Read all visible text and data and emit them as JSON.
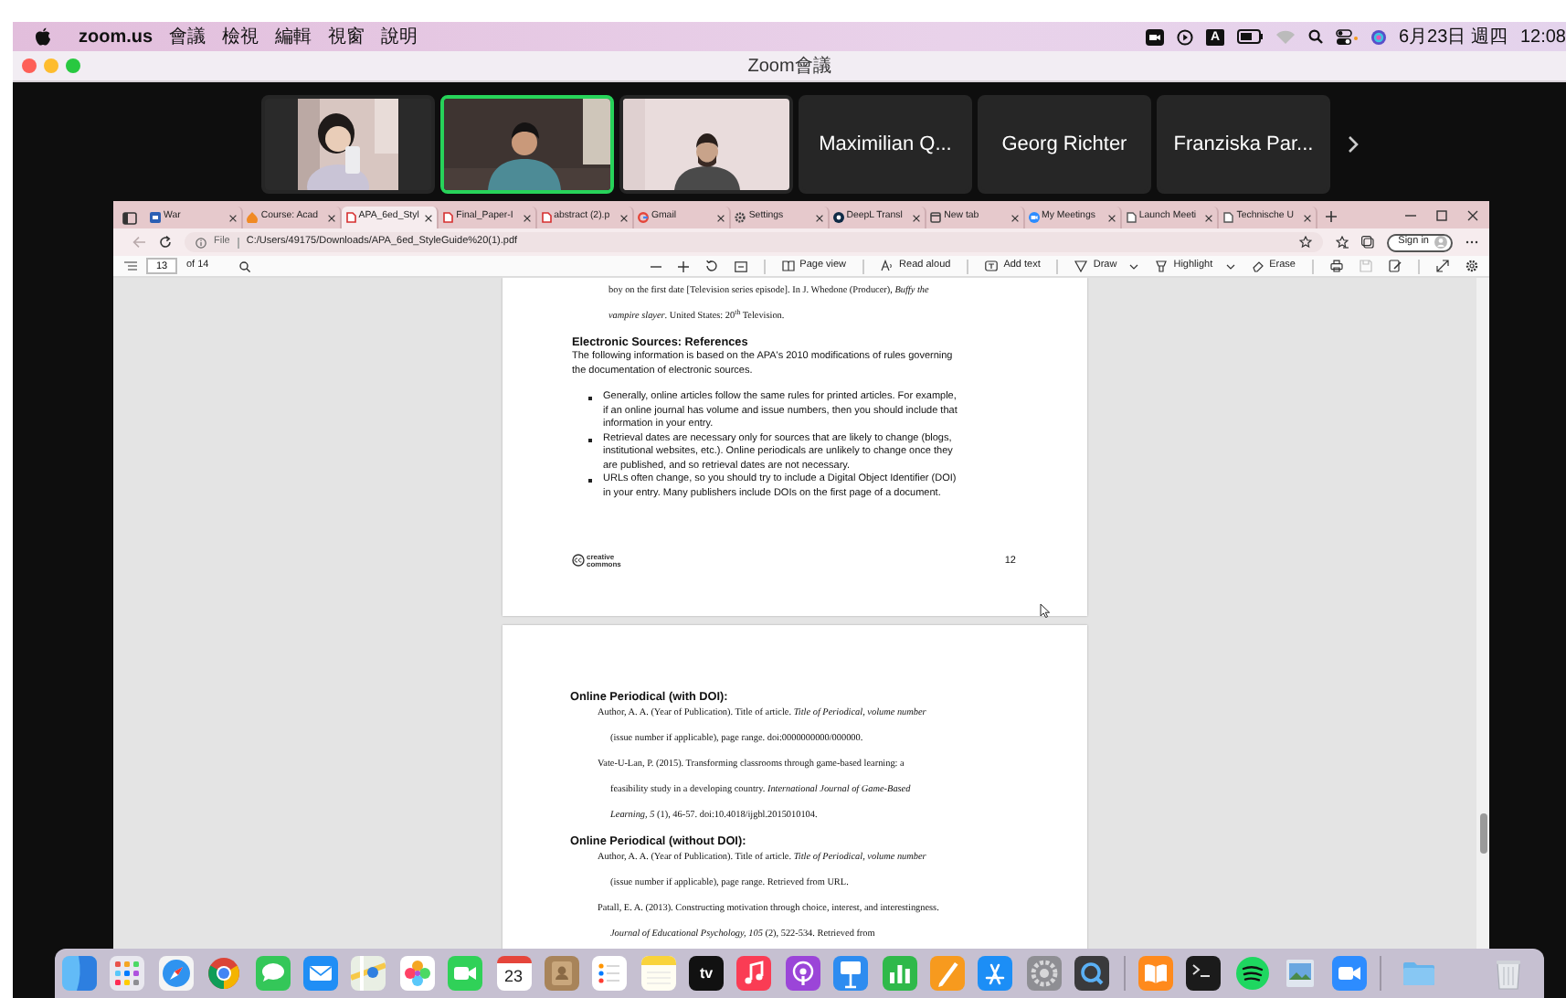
{
  "menu_bar": {
    "app": "zoom.us",
    "menus": [
      "會議",
      "檢視",
      "編輯",
      "視窗",
      "說明"
    ],
    "input_source": "A",
    "date": "6月23日 週四",
    "time": "12:08"
  },
  "window": {
    "title": "Zoom會議"
  },
  "participants": [
    {
      "kind": "video",
      "speaking": false
    },
    {
      "kind": "video",
      "speaking": true
    },
    {
      "kind": "video",
      "speaking": false
    },
    {
      "kind": "name",
      "name": "Maximilian Q...",
      "speaking": false
    },
    {
      "kind": "name",
      "name": "Georg Richter",
      "speaking": false
    },
    {
      "kind": "name",
      "name": "Franziska Par...",
      "speaking": false
    }
  ],
  "browser": {
    "tabs": [
      {
        "kind": "square",
        "title": "War",
        "selected": false
      },
      {
        "kind": "flame",
        "title": "Course: Acad",
        "selected": false
      },
      {
        "kind": "document",
        "title": "APA_6ed_Styl",
        "selected": true
      },
      {
        "kind": "document",
        "title": "Final_Paper-I",
        "selected": false
      },
      {
        "kind": "document",
        "title": "abstract (2).p",
        "selected": false
      },
      {
        "kind": "ring",
        "title": "Gmail",
        "selected": false
      },
      {
        "kind": "gear",
        "title": "Settings",
        "selected": false
      },
      {
        "kind": "circle",
        "title": "DeepL Transl",
        "selected": false
      },
      {
        "kind": "window",
        "title": "New tab",
        "selected": false
      },
      {
        "kind": "camera",
        "title": "My Meetings",
        "selected": false
      },
      {
        "kind": "page",
        "title": "Launch Meeti",
        "selected": false
      },
      {
        "kind": "page",
        "title": "Technische U",
        "selected": false
      }
    ],
    "back_disabled": true,
    "address": {
      "scheme": "File",
      "path": "C:/Users/49175/Downloads/APA_6ed_StyleGuide%20(1).pdf"
    },
    "sign_in": "Sign in"
  },
  "pdf_toolbar": {
    "page": "13",
    "total": "of 14",
    "save_disabled": true,
    "tools": [
      {
        "kind": "page-view",
        "label": "Page view",
        "menu": false
      },
      {
        "kind": "read-aloud",
        "label": "Read aloud",
        "menu": false
      },
      {
        "kind": "add-text",
        "label": "Add text",
        "menu": false
      },
      {
        "kind": "draw",
        "label": "Draw",
        "menu": true
      },
      {
        "kind": "highlight",
        "label": "Highlight",
        "menu": true
      },
      {
        "kind": "erase",
        "label": "Erase",
        "menu": false
      }
    ]
  },
  "pages": [
    {
      "blocks": [
        {
          "kind": "continuation",
          "lines": [
            "boy on the first date [Television series episode]. In J. Whedone (Producer), *Buffy the*",
            "*vampire slayer*. United States: 20$^{th}$ Television."
          ]
        },
        {
          "kind": "heading",
          "text": "Electronic Sources: References"
        },
        {
          "kind": "paragraph",
          "lines": [
            "The following information is based on the APA's 2010 modifications of rules governing",
            "the documentation of electronic sources."
          ]
        },
        {
          "kind": "bullets",
          "items": [
            {
              "lines": [
                "Generally, online articles follow the same rules for printed articles. For example,",
                "if an online journal has volume and issue numbers, then you should include that",
                "information in your entry."
              ]
            },
            {
              "lines": [
                "Retrieval dates are necessary only for sources that are likely to change (blogs,",
                "institutional websites, etc.). Online periodicals are unlikely to change once they",
                "are published, and so retrieval dates are not necessary."
              ]
            },
            {
              "lines": [
                "URLs often change, so you should try to include a Digital Object Identifier (DOI)",
                "in your entry. Many publishers include DOIs on the first page of a document."
              ]
            }
          ]
        }
      ],
      "footer": {
        "logo": "creative commons",
        "number": "12"
      }
    },
    {
      "blocks": [
        {
          "kind": "heading",
          "text": "Online Periodical (with DOI):"
        },
        {
          "kind": "reference",
          "lines": [
            "Author, A. A. (Year of Publication). Title of article. *Title of Periodical, volume number*",
            "(issue number if applicable), page range. doi:0000000000/000000."
          ]
        },
        {
          "kind": "reference",
          "lines": [
            "Vate-U-Lan, P. (2015). Transforming classrooms through game-based learning: a",
            "feasibility study in a developing country. *International Journal of Game-Based*",
            "*Learning, 5* (1), 46-57. doi:10.4018/ijgbl.2015010104."
          ]
        },
        {
          "kind": "heading",
          "text": "Online Periodical (without DOI):"
        },
        {
          "kind": "reference",
          "lines": [
            "Author, A. A. (Year of Publication). Title of article. *Title of Periodical, volume number*",
            "(issue number if applicable), page range. Retrieved from URL."
          ]
        },
        {
          "kind": "reference",
          "lines": [
            "Patall, E. A. (2013). Constructing motivation through choice, interest, and interestingness.",
            "*Journal of Educational Psychology, 105* (2), 522-534. Retrieved from"
          ]
        }
      ]
    }
  ],
  "dock": [
    {
      "kind": "finder"
    },
    {
      "kind": "launchpad"
    },
    {
      "kind": "safari"
    },
    {
      "kind": "chrome"
    },
    {
      "kind": "messages"
    },
    {
      "kind": "mail"
    },
    {
      "kind": "maps"
    },
    {
      "kind": "photos"
    },
    {
      "kind": "facetime"
    },
    {
      "kind": "calendar",
      "label": "23"
    },
    {
      "kind": "contacts"
    },
    {
      "kind": "reminders"
    },
    {
      "kind": "notes"
    },
    {
      "kind": "tv",
      "label": "tv"
    },
    {
      "kind": "music"
    },
    {
      "kind": "podcasts"
    },
    {
      "kind": "keynote"
    },
    {
      "kind": "numbers"
    },
    {
      "kind": "pages"
    },
    {
      "kind": "appstore"
    },
    {
      "kind": "settings"
    },
    {
      "kind": "quicktime"
    },
    {
      "kind": "separator"
    },
    {
      "kind": "books"
    },
    {
      "kind": "terminal"
    },
    {
      "kind": "spotify"
    },
    {
      "kind": "preview"
    },
    {
      "kind": "zoom"
    },
    {
      "kind": "separator"
    },
    {
      "kind": "folder"
    },
    {
      "kind": "trash"
    }
  ]
}
